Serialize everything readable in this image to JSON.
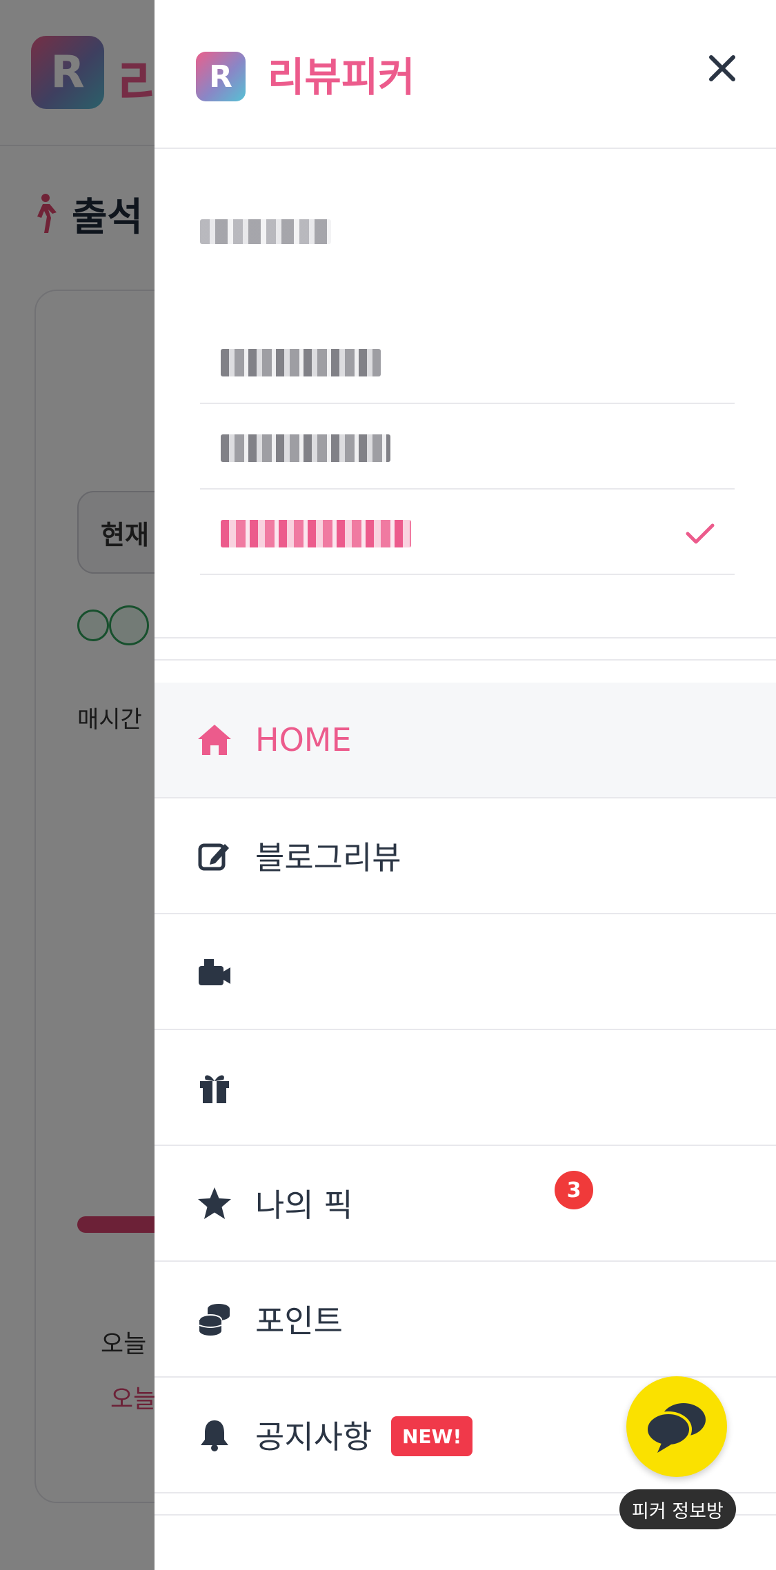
{
  "background": {
    "brand_initial": "R",
    "brand_partial": "리",
    "section_title_partial": "출석",
    "current_label_partial": "현재",
    "hourly_text_partial": "매시간",
    "today_text_partial_1": "오늘",
    "today_text_partial_2": "오늘"
  },
  "drawer": {
    "logo_initial": "R",
    "brand_name": "리뷰피커",
    "menu": {
      "home_label": "HOME",
      "blog_review_label": "블로그리뷰",
      "mission_label": "",
      "event_label": "",
      "my_pick_label": "나의 픽",
      "my_pick_badge": "3",
      "points_label": "포인트",
      "notice_label": "공지사항",
      "notice_badge": "NEW!"
    }
  },
  "chat_fab": {
    "label": "피커 정보방"
  },
  "colors": {
    "brand_pink": "#ec5b8c",
    "text_dark": "#2b3544",
    "kakao_yellow": "#fae100",
    "badge_red": "#f03a3a"
  },
  "icons": {
    "close": "close-icon",
    "home": "home-icon",
    "blog": "edit-icon",
    "mission": "camera-icon",
    "event": "gift-icon",
    "my_pick": "star-icon",
    "points": "coins-icon",
    "notice": "bell-icon",
    "selected_account": "check-icon",
    "chat": "chat-bubbles-icon"
  }
}
